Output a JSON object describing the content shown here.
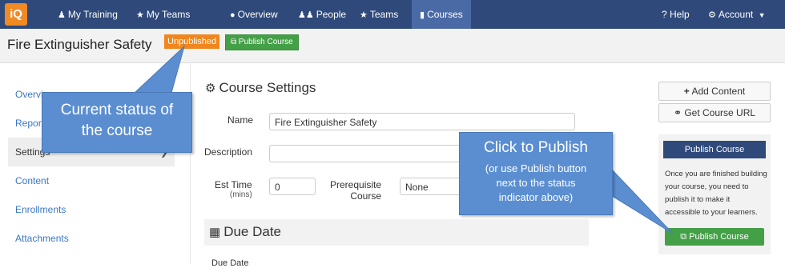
{
  "nav": {
    "logo": "iQ",
    "my_training": "My Training",
    "my_teams": "My Teams",
    "overview": "Overview",
    "people": "People",
    "teams": "Teams",
    "courses": "Courses",
    "help": "? Help",
    "account": "Account"
  },
  "course": {
    "title": "Fire Extinguisher Safety",
    "status": "Unpublished",
    "publish_button": "Publish Course"
  },
  "sidebar": {
    "items": [
      {
        "label": "Overvi"
      },
      {
        "label": "Report"
      },
      {
        "label": "Settings"
      },
      {
        "label": "Content"
      },
      {
        "label": "Enrollments"
      },
      {
        "label": "Attachments"
      }
    ]
  },
  "settings": {
    "section_title": "Course Settings",
    "name_label": "Name",
    "name_value": "Fire Extinguisher Safety",
    "description_label": "Description",
    "description_value": "",
    "est_time_label": "Est Time",
    "est_time_unit": "(mins)",
    "est_time_value": "0",
    "prereq_label_1": "Prerequisite",
    "prereq_label_2": "Course",
    "prereq_value": "None"
  },
  "due": {
    "title": "Due Date",
    "field_label": "Due Date"
  },
  "right_panel": {
    "add_content": "Add Content",
    "get_url": "Get Course URL",
    "publish_head": "Publish Course",
    "publish_desc": "Once you are finished building your course, you need to publish it to make it accessible to your learners.",
    "publish_button": "Publish Course"
  },
  "callouts": {
    "status_line1": "Current status of",
    "status_line2": "the course",
    "publish_line1": "Click to Publish",
    "publish_line2": "(or use Publish button",
    "publish_line3": "next to the status",
    "publish_line4": "indicator above)"
  },
  "colors": {
    "nav_bg": "#2f4a7a",
    "accent_orange": "#f0861d",
    "accent_green": "#43a047",
    "callout_blue": "#5b8ed1",
    "link_blue": "#3a77c5"
  }
}
